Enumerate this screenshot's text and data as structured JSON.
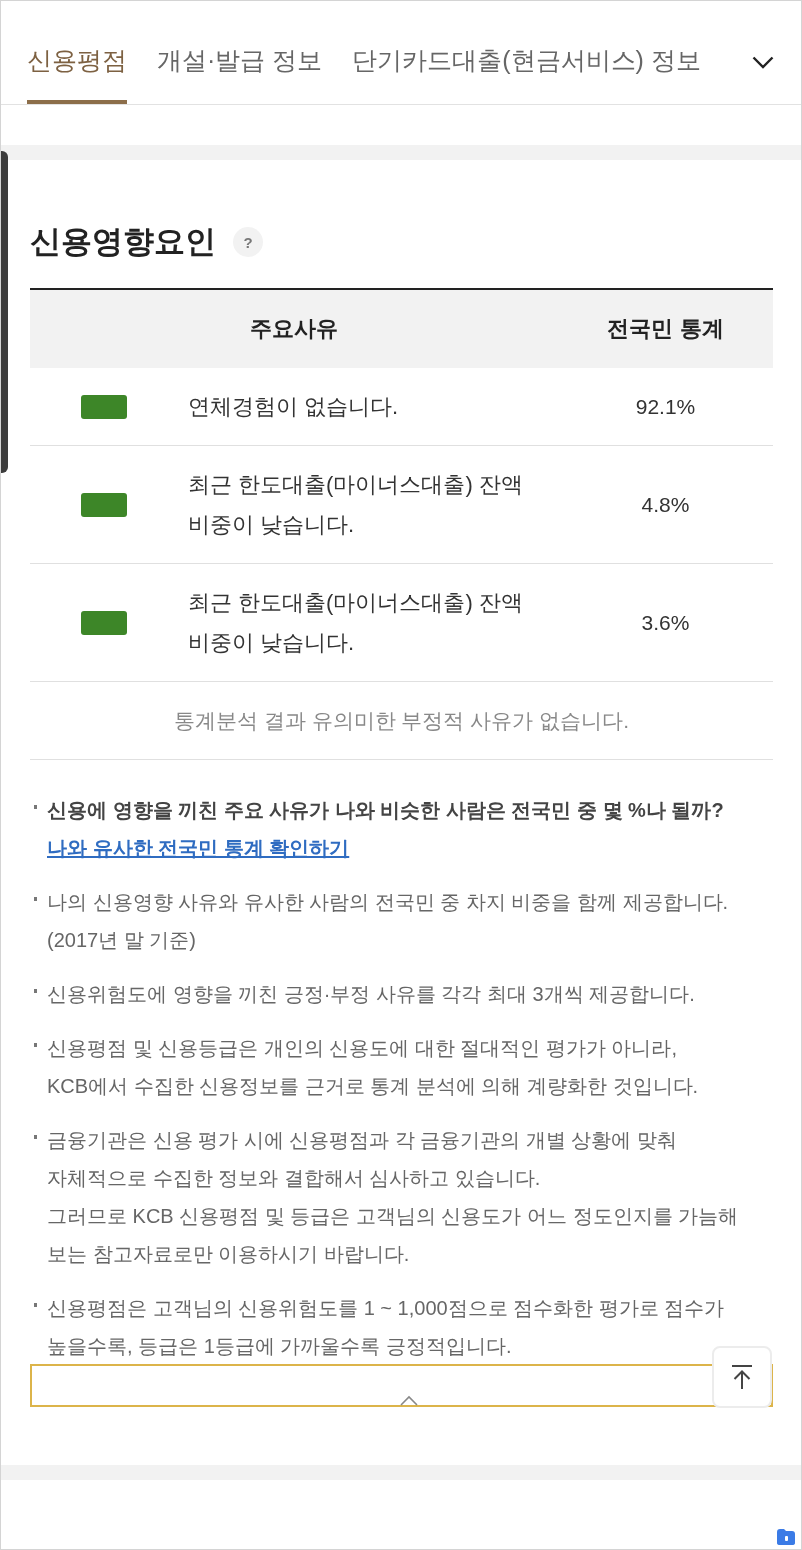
{
  "tabs": [
    {
      "label": "신용평점",
      "selected": true
    },
    {
      "label": "개설·발급 정보",
      "selected": false
    },
    {
      "label": "단기카드대출(현금서비스) 정보",
      "selected": false
    }
  ],
  "section": {
    "title": "신용영향요인",
    "help_label": "?"
  },
  "table": {
    "columns": [
      "주요사유",
      "전국민 통계"
    ],
    "rows": [
      {
        "color": "#3d8628",
        "reason": [
          "연체경험이 없습니다."
        ],
        "share": "92.1%"
      },
      {
        "color": "#3d8628",
        "reason": [
          "최근 한도대출(마이너스대출) 잔액",
          "비중이 낮습니다."
        ],
        "share": "4.8%"
      },
      {
        "color": "#3d8628",
        "reason": [
          "최근 한도대출(마이너스대출) 잔액",
          "비중이 낮습니다."
        ],
        "share": "3.6%"
      }
    ],
    "footer_note": "통계분석 결과 유의미한 부정적 사유가 없습니다."
  },
  "notes": [
    {
      "kind": "question",
      "lines": [
        "신용에 영향을 끼친 주요 사유가 나와 비슷한 사람은 전국민 중 몇 %나 될까?"
      ],
      "link": "나와 유사한 전국민 통계 확인하기"
    },
    {
      "kind": "plain",
      "lines": [
        "나의 신용영향 사유와 유사한 사람의 전국민 중 차지 비중을 함께 제공합니다.",
        "(2017년 말 기준)"
      ]
    },
    {
      "kind": "plain",
      "lines": [
        "신용위험도에 영향을 끼친 긍정·부정 사유를 각각 최대 3개씩 제공합니다."
      ]
    },
    {
      "kind": "plain",
      "lines": [
        "신용평점 및 신용등급은 개인의 신용도에 대한 절대적인 평가가 아니라,",
        "KCB에서 수집한 신용정보를 근거로 통계 분석에 의해 계량화한 것입니다."
      ]
    },
    {
      "kind": "plain",
      "lines": [
        "금융기관은 신용 평가 시에 신용평점과 각 금융기관의 개별 상황에 맞춰",
        "자체적으로 수집한 정보와 결합해서 심사하고 있습니다.",
        "그러므로 KCB 신용평점 및 등급은 고객님의 신용도가 어느 정도인지를 가늠해",
        "보는 참고자료로만 이용하시기 바랍니다."
      ]
    },
    {
      "kind": "plain",
      "lines": [
        "신용평점은 고객님의 신용위험도를 1 ~ 1,000점으로 점수화한 평가로 점수가",
        "높을수록, 등급은 1등급에 가까울수록 긍정적입니다."
      ]
    }
  ]
}
